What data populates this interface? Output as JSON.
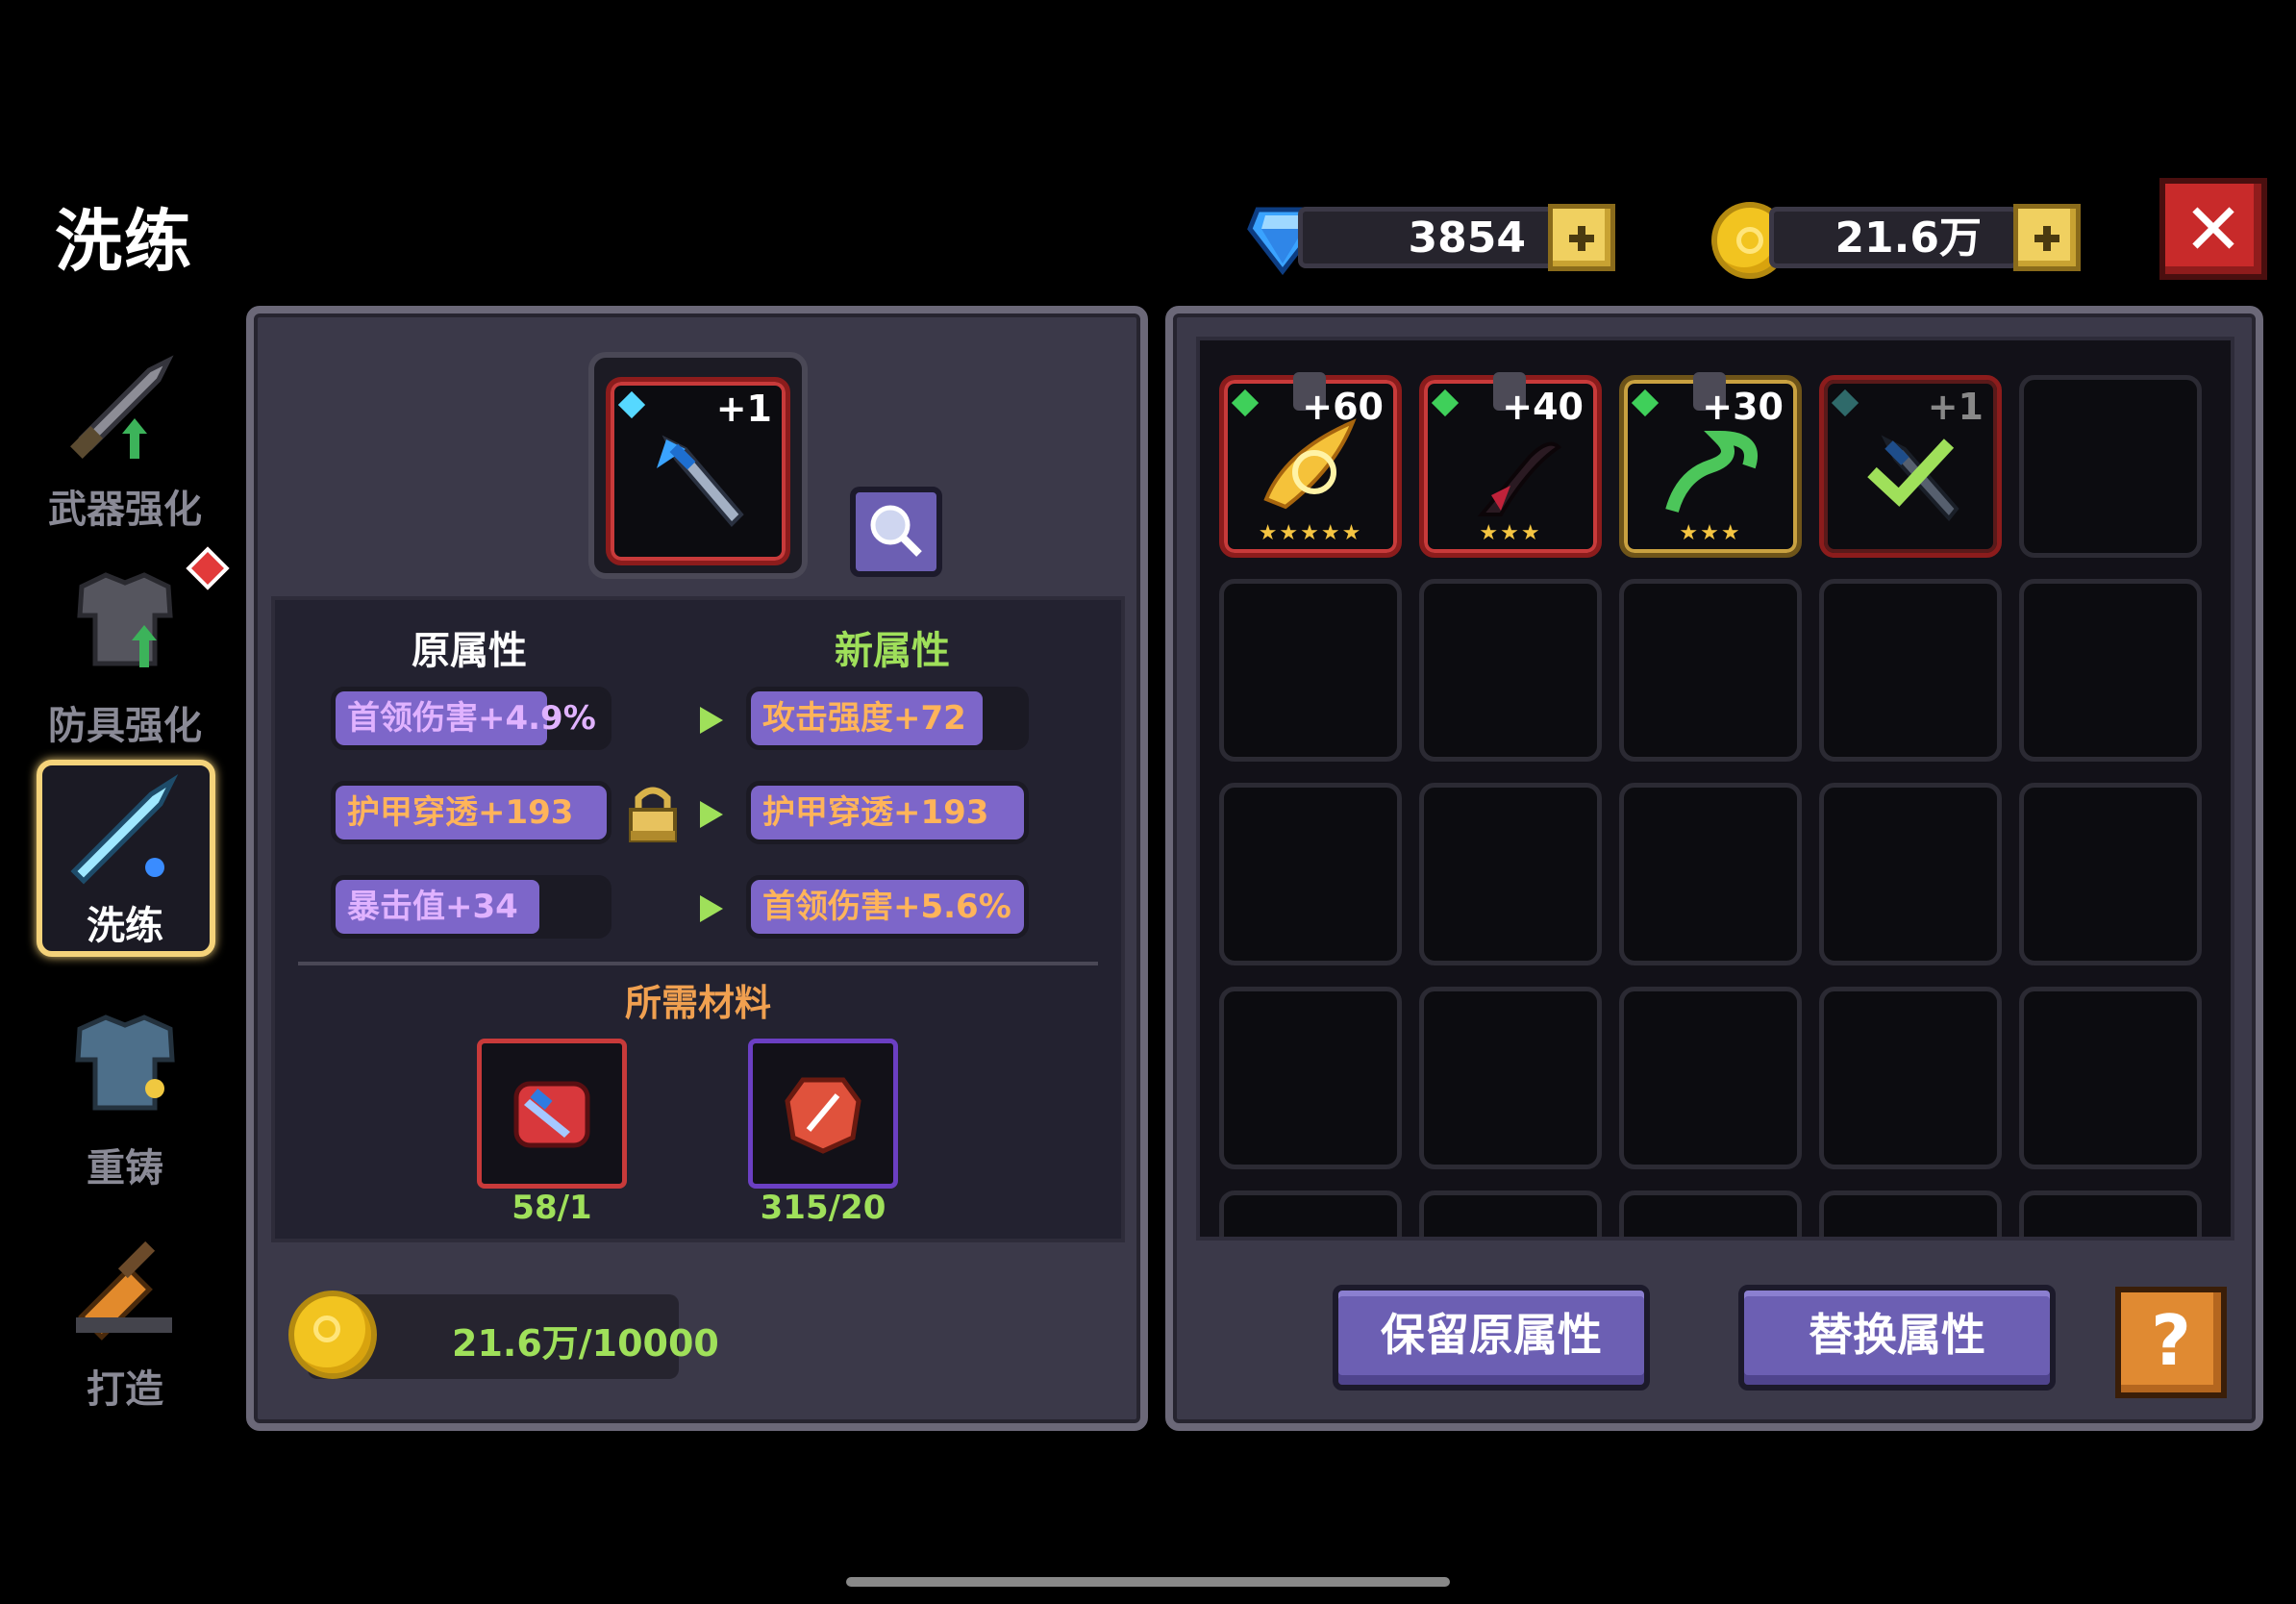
{
  "header": {
    "title": "洗练",
    "gems": "3854",
    "gold": "21.6万"
  },
  "sidebar": {
    "items": [
      {
        "label": "武器强化",
        "icon": "sword-upgrade-icon",
        "active": false
      },
      {
        "label": "防具强化",
        "icon": "armor-upgrade-icon",
        "active": false,
        "badge": true
      },
      {
        "label": "洗练",
        "icon": "crystal-sword-icon",
        "active": true
      },
      {
        "label": "重铸",
        "icon": "reforge-armor-icon",
        "active": false
      },
      {
        "label": "打造",
        "icon": "forge-hammer-icon",
        "active": false
      }
    ]
  },
  "reroll": {
    "item_level": "+1",
    "original_header": "原属性",
    "new_header": "新属性",
    "original_attrs": [
      {
        "text": "首领伤害+4.9%",
        "fill": 0.78,
        "color": "purple"
      },
      {
        "text": "护甲穿透+193",
        "fill": 1.0,
        "color": "orange"
      },
      {
        "text": "暴击值+34",
        "fill": 0.75,
        "color": "purple"
      }
    ],
    "new_attrs": [
      {
        "text": "攻击强度+72",
        "fill": 0.85,
        "color": "orange"
      },
      {
        "text": "护甲穿透+193",
        "fill": 1.0,
        "color": "orange"
      },
      {
        "text": "首领伤害+5.6%",
        "fill": 1.0,
        "color": "orange"
      }
    ],
    "materials_title": "所需材料",
    "materials": [
      {
        "icon": "red-weapon-scroll-icon",
        "count": "58/1"
      },
      {
        "icon": "red-stone-icon",
        "count": "315/20"
      }
    ],
    "gold_cost": "21.6万/10000"
  },
  "inventory": {
    "items": [
      {
        "level": "+60",
        "icon": "golden-flame-blade-icon",
        "stars": "★★★★★",
        "frame": "red",
        "locked": true
      },
      {
        "level": "+40",
        "icon": "dark-scythe-icon",
        "stars": "★★★",
        "frame": "red",
        "locked": true
      },
      {
        "level": "+30",
        "icon": "green-serpent-whip-icon",
        "stars": "★★★",
        "frame": "gold",
        "locked": true
      },
      {
        "level": "+1",
        "icon": "crystal-dagger-icon",
        "stars": "",
        "frame": "red",
        "locked": false,
        "selected": true
      }
    ]
  },
  "actions": {
    "keep": "保留原属性",
    "replace": "替换属性",
    "help": "?"
  }
}
